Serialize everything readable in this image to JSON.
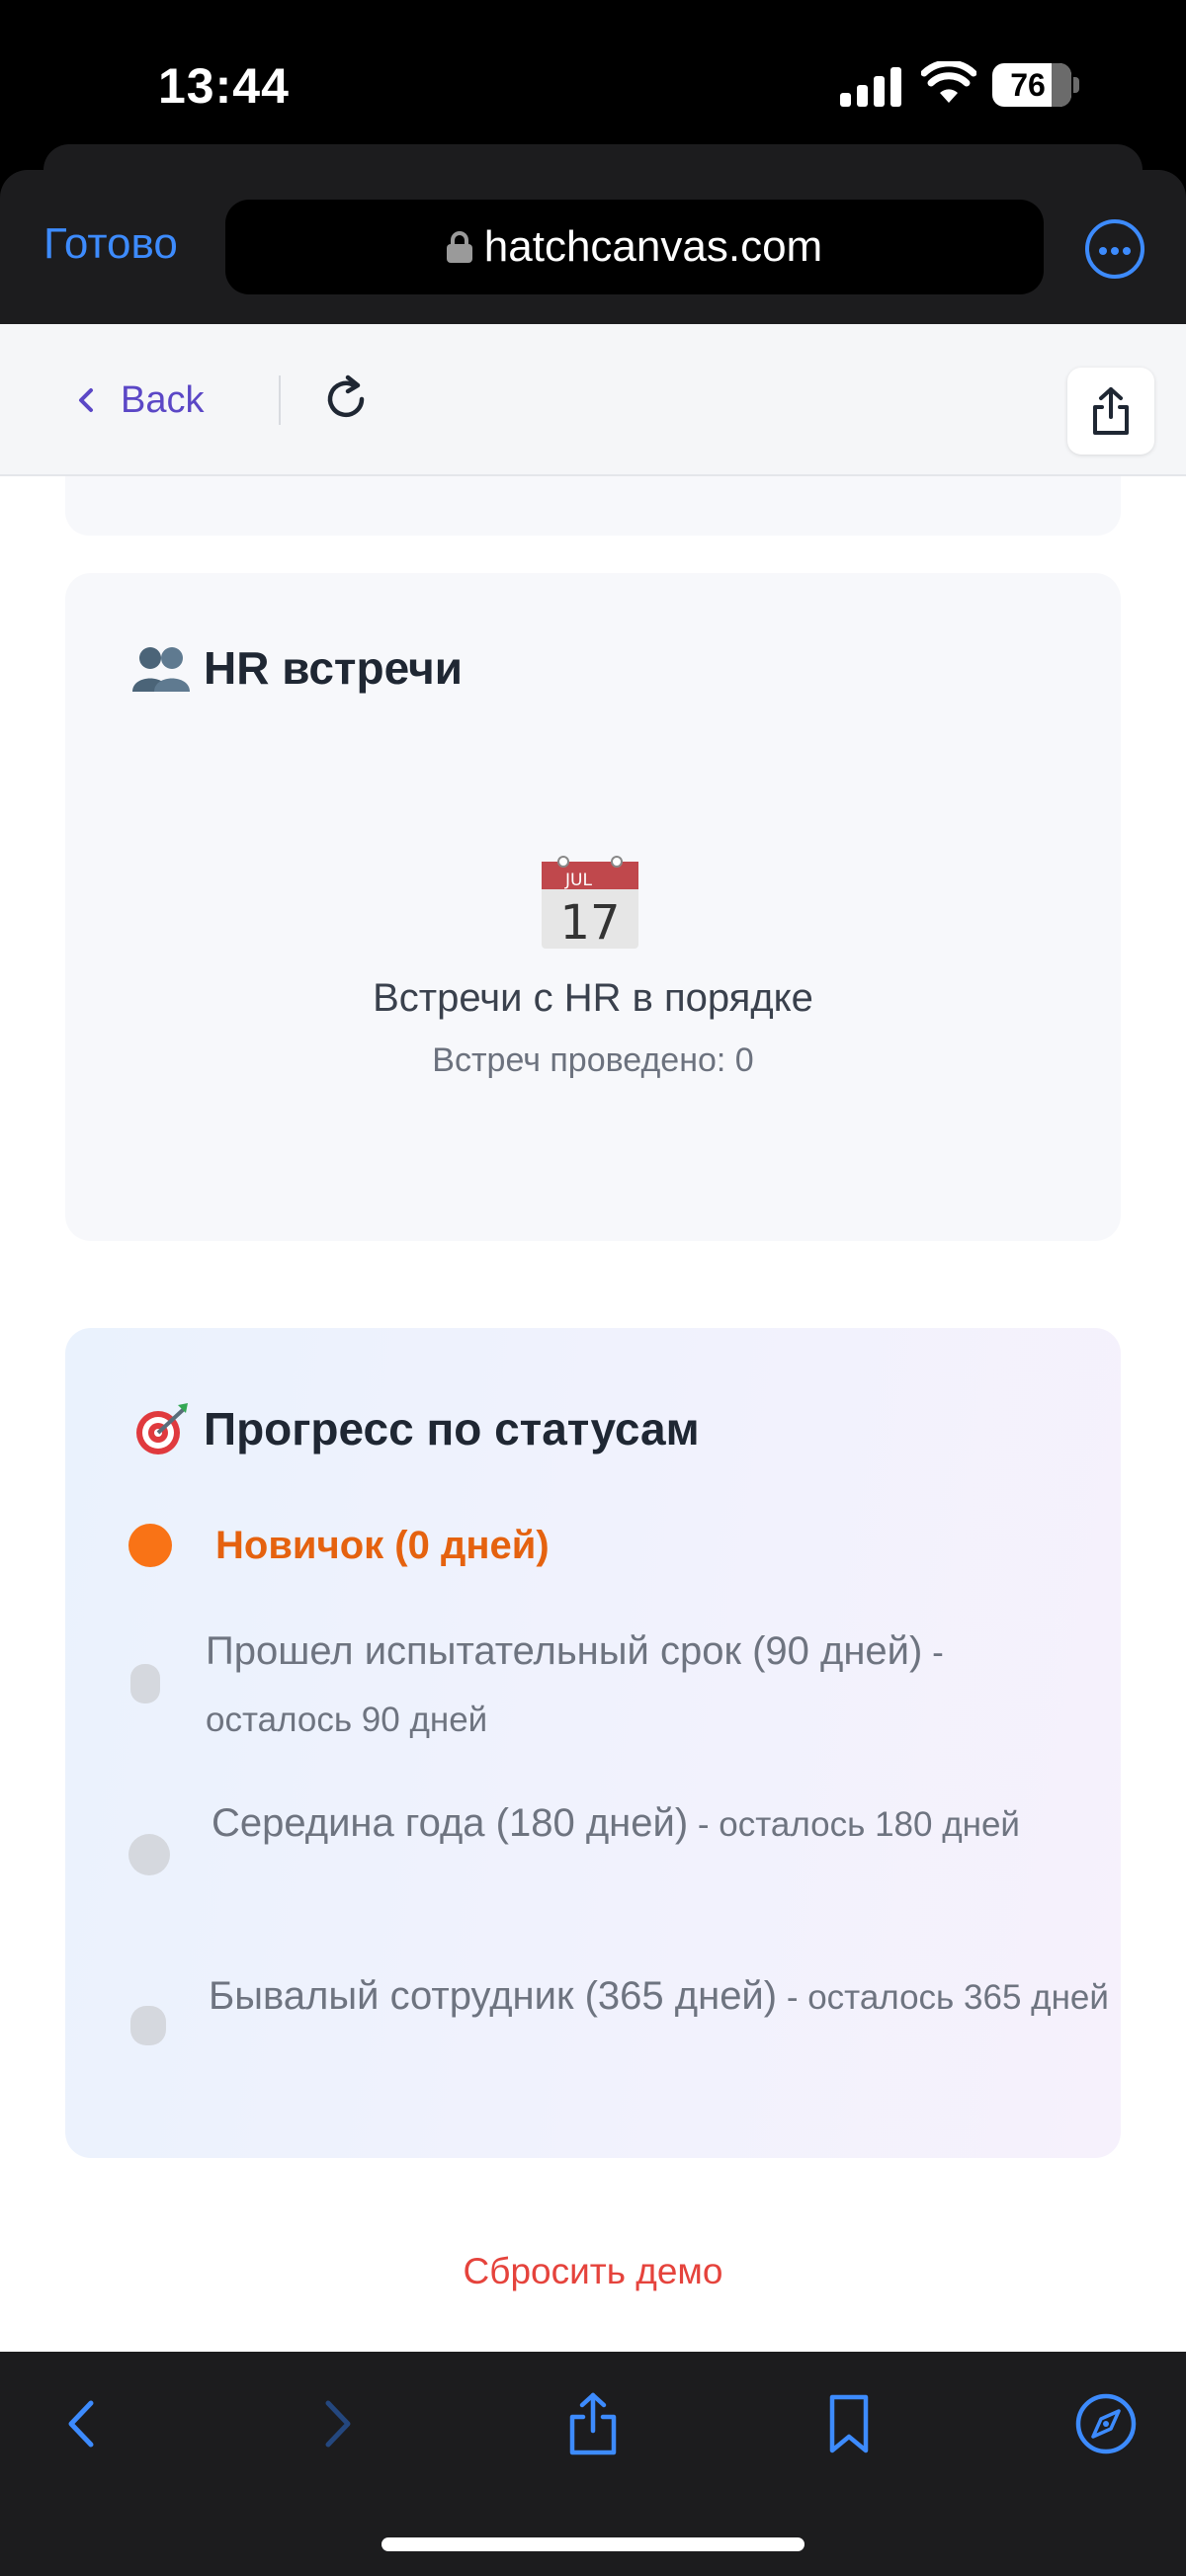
{
  "status_bar": {
    "time": "13:44",
    "battery": "76",
    "icons": [
      "signal-icon",
      "wifi-icon",
      "battery-icon"
    ]
  },
  "browser": {
    "done_label": "Готово",
    "url": "hatchcanvas.com",
    "accent_color": "#3d8bfd"
  },
  "app_nav": {
    "back_label": "Back",
    "icons": [
      "chevron-left-icon",
      "reload-icon",
      "share-icon"
    ]
  },
  "hr_card": {
    "emoji": "people-icon",
    "title": "HR встречи",
    "empty_icon": "calendar-icon",
    "calendar_month": "JUL",
    "calendar_day": "17",
    "main_text": "Встречи с HR в порядке",
    "sub_text": "Встреч проведено: 0"
  },
  "progress_card": {
    "emoji": "target-icon",
    "title": "Прогресс по статусам",
    "statuses": [
      {
        "label": "Новичок (0 дней)",
        "remaining": "",
        "active": true,
        "color": "#f97316"
      },
      {
        "label": "Прошел испытательный срок (90 дней)",
        "remaining": " - осталось 90 дней",
        "active": false,
        "color": "#d5d8de"
      },
      {
        "label": "Середина года (180 дней)",
        "remaining": " - осталось 180 дней",
        "active": false,
        "color": "#d5d8de"
      },
      {
        "label": "Бывалый сотрудник (365 дней)",
        "remaining": " - осталось 365 дней",
        "active": false,
        "color": "#d5d8de"
      }
    ]
  },
  "reset_label": "Сбросить демо",
  "toolbar": {
    "icons": [
      "back-arrow-icon",
      "forward-arrow-icon",
      "share-icon",
      "bookmarks-icon",
      "compass-icon"
    ]
  }
}
